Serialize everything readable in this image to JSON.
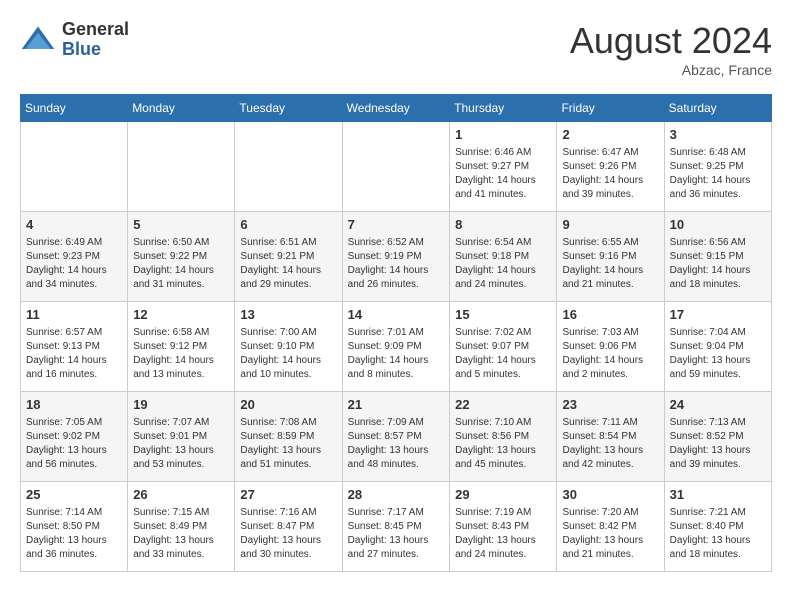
{
  "header": {
    "logo_general": "General",
    "logo_blue": "Blue",
    "month_year": "August 2024",
    "location": "Abzac, France"
  },
  "weekdays": [
    "Sunday",
    "Monday",
    "Tuesday",
    "Wednesday",
    "Thursday",
    "Friday",
    "Saturday"
  ],
  "weeks": [
    [
      {
        "day": "",
        "info": ""
      },
      {
        "day": "",
        "info": ""
      },
      {
        "day": "",
        "info": ""
      },
      {
        "day": "",
        "info": ""
      },
      {
        "day": "1",
        "info": "Sunrise: 6:46 AM\nSunset: 9:27 PM\nDaylight: 14 hours and 41 minutes."
      },
      {
        "day": "2",
        "info": "Sunrise: 6:47 AM\nSunset: 9:26 PM\nDaylight: 14 hours and 39 minutes."
      },
      {
        "day": "3",
        "info": "Sunrise: 6:48 AM\nSunset: 9:25 PM\nDaylight: 14 hours and 36 minutes."
      }
    ],
    [
      {
        "day": "4",
        "info": "Sunrise: 6:49 AM\nSunset: 9:23 PM\nDaylight: 14 hours and 34 minutes."
      },
      {
        "day": "5",
        "info": "Sunrise: 6:50 AM\nSunset: 9:22 PM\nDaylight: 14 hours and 31 minutes."
      },
      {
        "day": "6",
        "info": "Sunrise: 6:51 AM\nSunset: 9:21 PM\nDaylight: 14 hours and 29 minutes."
      },
      {
        "day": "7",
        "info": "Sunrise: 6:52 AM\nSunset: 9:19 PM\nDaylight: 14 hours and 26 minutes."
      },
      {
        "day": "8",
        "info": "Sunrise: 6:54 AM\nSunset: 9:18 PM\nDaylight: 14 hours and 24 minutes."
      },
      {
        "day": "9",
        "info": "Sunrise: 6:55 AM\nSunset: 9:16 PM\nDaylight: 14 hours and 21 minutes."
      },
      {
        "day": "10",
        "info": "Sunrise: 6:56 AM\nSunset: 9:15 PM\nDaylight: 14 hours and 18 minutes."
      }
    ],
    [
      {
        "day": "11",
        "info": "Sunrise: 6:57 AM\nSunset: 9:13 PM\nDaylight: 14 hours and 16 minutes."
      },
      {
        "day": "12",
        "info": "Sunrise: 6:58 AM\nSunset: 9:12 PM\nDaylight: 14 hours and 13 minutes."
      },
      {
        "day": "13",
        "info": "Sunrise: 7:00 AM\nSunset: 9:10 PM\nDaylight: 14 hours and 10 minutes."
      },
      {
        "day": "14",
        "info": "Sunrise: 7:01 AM\nSunset: 9:09 PM\nDaylight: 14 hours and 8 minutes."
      },
      {
        "day": "15",
        "info": "Sunrise: 7:02 AM\nSunset: 9:07 PM\nDaylight: 14 hours and 5 minutes."
      },
      {
        "day": "16",
        "info": "Sunrise: 7:03 AM\nSunset: 9:06 PM\nDaylight: 14 hours and 2 minutes."
      },
      {
        "day": "17",
        "info": "Sunrise: 7:04 AM\nSunset: 9:04 PM\nDaylight: 13 hours and 59 minutes."
      }
    ],
    [
      {
        "day": "18",
        "info": "Sunrise: 7:05 AM\nSunset: 9:02 PM\nDaylight: 13 hours and 56 minutes."
      },
      {
        "day": "19",
        "info": "Sunrise: 7:07 AM\nSunset: 9:01 PM\nDaylight: 13 hours and 53 minutes."
      },
      {
        "day": "20",
        "info": "Sunrise: 7:08 AM\nSunset: 8:59 PM\nDaylight: 13 hours and 51 minutes."
      },
      {
        "day": "21",
        "info": "Sunrise: 7:09 AM\nSunset: 8:57 PM\nDaylight: 13 hours and 48 minutes."
      },
      {
        "day": "22",
        "info": "Sunrise: 7:10 AM\nSunset: 8:56 PM\nDaylight: 13 hours and 45 minutes."
      },
      {
        "day": "23",
        "info": "Sunrise: 7:11 AM\nSunset: 8:54 PM\nDaylight: 13 hours and 42 minutes."
      },
      {
        "day": "24",
        "info": "Sunrise: 7:13 AM\nSunset: 8:52 PM\nDaylight: 13 hours and 39 minutes."
      }
    ],
    [
      {
        "day": "25",
        "info": "Sunrise: 7:14 AM\nSunset: 8:50 PM\nDaylight: 13 hours and 36 minutes."
      },
      {
        "day": "26",
        "info": "Sunrise: 7:15 AM\nSunset: 8:49 PM\nDaylight: 13 hours and 33 minutes."
      },
      {
        "day": "27",
        "info": "Sunrise: 7:16 AM\nSunset: 8:47 PM\nDaylight: 13 hours and 30 minutes."
      },
      {
        "day": "28",
        "info": "Sunrise: 7:17 AM\nSunset: 8:45 PM\nDaylight: 13 hours and 27 minutes."
      },
      {
        "day": "29",
        "info": "Sunrise: 7:19 AM\nSunset: 8:43 PM\nDaylight: 13 hours and 24 minutes."
      },
      {
        "day": "30",
        "info": "Sunrise: 7:20 AM\nSunset: 8:42 PM\nDaylight: 13 hours and 21 minutes."
      },
      {
        "day": "31",
        "info": "Sunrise: 7:21 AM\nSunset: 8:40 PM\nDaylight: 13 hours and 18 minutes."
      }
    ]
  ]
}
